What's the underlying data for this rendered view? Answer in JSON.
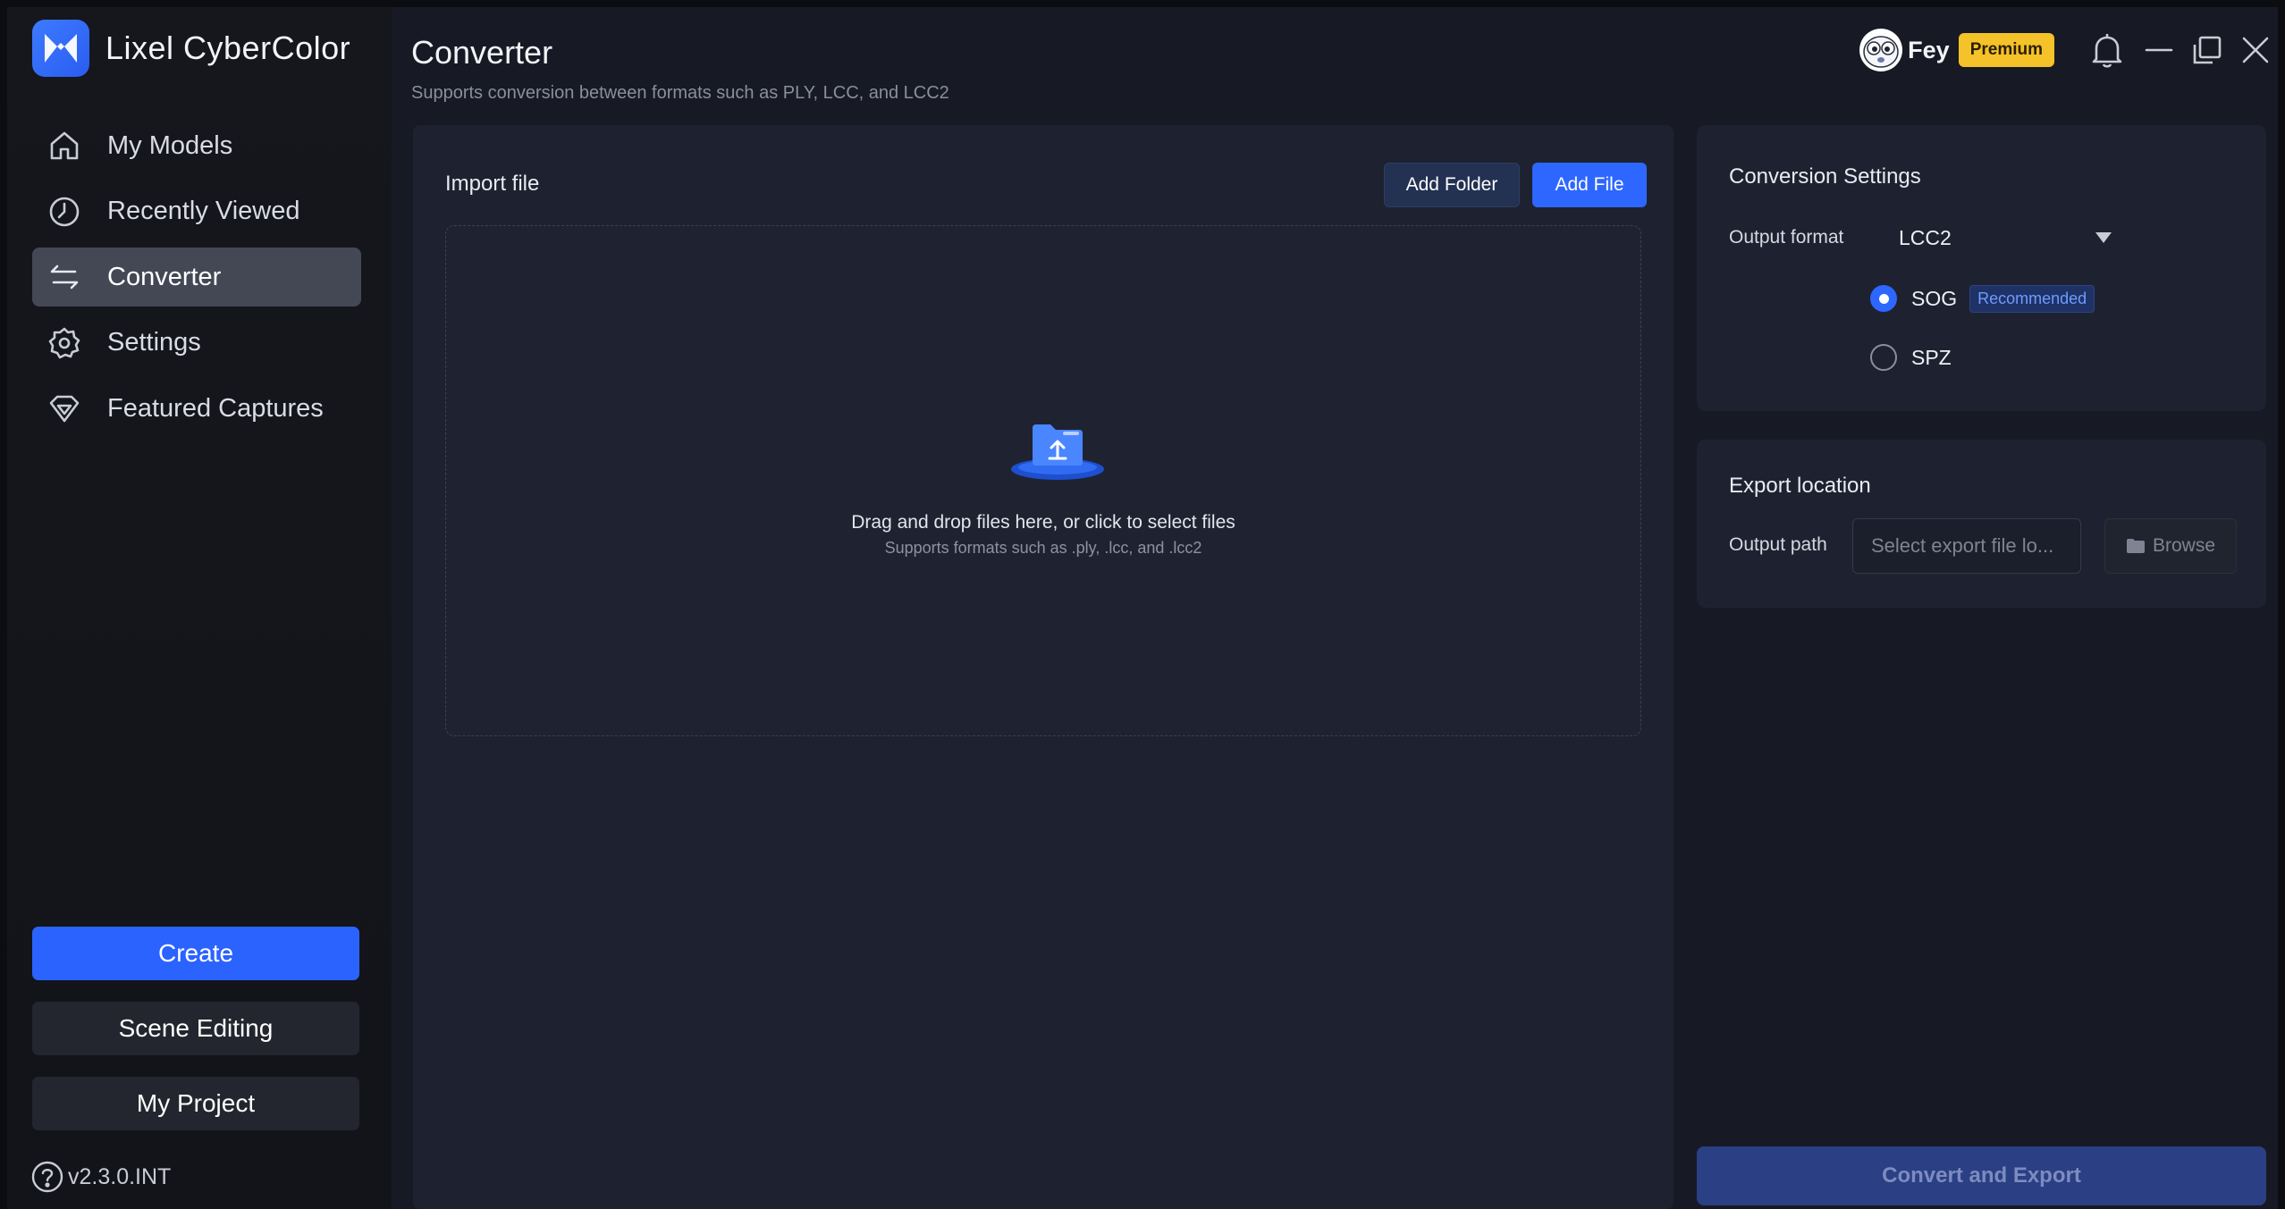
{
  "app": {
    "name": "Lixel CyberColor",
    "version": "v2.3.0.INT"
  },
  "sidebar": {
    "items": [
      {
        "label": "My Models",
        "icon": "home-icon"
      },
      {
        "label": "Recently Viewed",
        "icon": "clock-icon"
      },
      {
        "label": "Converter",
        "icon": "convert-arrows-icon",
        "active": true
      },
      {
        "label": "Settings",
        "icon": "gear-icon"
      },
      {
        "label": "Featured Captures",
        "icon": "diamond-icon"
      }
    ],
    "buttons": {
      "create": "Create",
      "scene_editing": "Scene Editing",
      "my_project": "My Project"
    }
  },
  "header": {
    "title": "Converter",
    "subtitle": "Supports conversion between formats such as PLY, LCC, and LCC2",
    "user_name": "Fey",
    "premium_label": "Premium"
  },
  "import": {
    "label": "Import file",
    "add_folder": "Add Folder",
    "add_file": "Add File",
    "drop_main": "Drag and drop files here, or click to select files",
    "drop_sub": "Supports formats such as .ply, .lcc, and .lcc2"
  },
  "settings": {
    "title": "Conversion Settings",
    "output_format_label": "Output format",
    "output_format_value": "LCC2",
    "options": [
      {
        "label": "SOG",
        "checked": true,
        "badge": "Recommended"
      },
      {
        "label": "SPZ",
        "checked": false
      }
    ]
  },
  "export": {
    "title": "Export location",
    "output_path_label": "Output path",
    "output_path_placeholder": "Select export file lo...",
    "browse_label": "Browse"
  },
  "convert_label": "Convert and Export",
  "colors": {
    "accent": "#2e67ff",
    "premium": "#f5c22a",
    "background": "#171a24",
    "panel": "#1e2230"
  }
}
